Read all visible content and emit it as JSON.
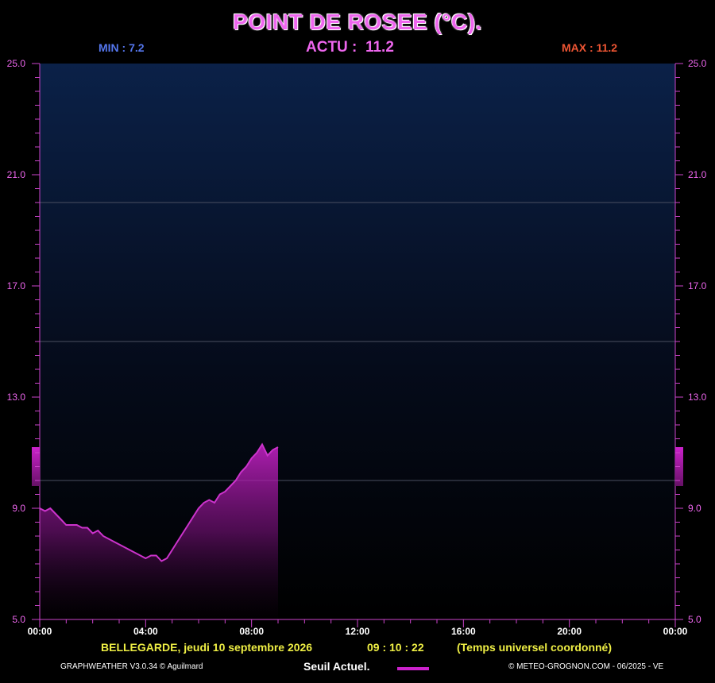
{
  "chart_data": {
    "type": "area",
    "title": "POINT DE ROSEE  (°C).",
    "stats": {
      "min_label": "MIN :",
      "min_value": "7.2",
      "max_label": "MAX :",
      "max_value": "11.2",
      "actu_label": "ACTU :",
      "actu_value": "11.2"
    },
    "ylim": [
      5,
      25
    ],
    "yticks": [
      "5.0",
      "9.0",
      "13.0",
      "17.0",
      "21.0",
      "25.0"
    ],
    "xlim": [
      0,
      24
    ],
    "xticks": [
      "00:00",
      "04:00",
      "08:00",
      "12:00",
      "16:00",
      "20:00",
      "00:00"
    ],
    "threshold_lines": [
      10.0,
      15.0,
      20.0
    ],
    "current_value_band": [
      9.8,
      11.2
    ],
    "series": [
      {
        "x": [
          0.0,
          0.2,
          0.4,
          0.6,
          0.8,
          1.0,
          1.2,
          1.4,
          1.6,
          1.8,
          2.0,
          2.2,
          2.4,
          2.6,
          2.8,
          3.0,
          3.2,
          3.4,
          3.6,
          3.8,
          4.0,
          4.2,
          4.4,
          4.6,
          4.8,
          5.0,
          5.2,
          5.4,
          5.6,
          5.8,
          6.0,
          6.2,
          6.4,
          6.6,
          6.8,
          7.0,
          7.2,
          7.4,
          7.6,
          7.8,
          8.0,
          8.2,
          8.4,
          8.6,
          8.8,
          9.0
        ],
        "values": [
          9.0,
          8.9,
          9.0,
          8.8,
          8.6,
          8.4,
          8.4,
          8.4,
          8.3,
          8.3,
          8.1,
          8.2,
          8.0,
          7.9,
          7.8,
          7.7,
          7.6,
          7.5,
          7.4,
          7.3,
          7.2,
          7.3,
          7.3,
          7.1,
          7.2,
          7.5,
          7.8,
          8.1,
          8.4,
          8.7,
          9.0,
          9.2,
          9.3,
          9.2,
          9.5,
          9.6,
          9.8,
          10.0,
          10.3,
          10.5,
          10.8,
          11.0,
          11.3,
          10.9,
          11.1,
          11.2
        ]
      }
    ]
  },
  "footer": {
    "location": "BELLEGARDE,  jeudi 10 septembre 2026",
    "time": "09 : 10 : 22",
    "timezone": "(Temps universel coordonné)",
    "credit_left": "GRAPHWEATHER V3.0.34 © Aguilmard",
    "legend_label": "Seuil Actuel.",
    "credit_right": "© METEO-GROGNON.COM - 06/2025     - VE"
  },
  "colors": {
    "background": "#000000",
    "accent": "#ee66ee",
    "series": "#cc22cc",
    "min": "#5577ee",
    "max": "#ee5533",
    "footer": "#eeee44"
  }
}
